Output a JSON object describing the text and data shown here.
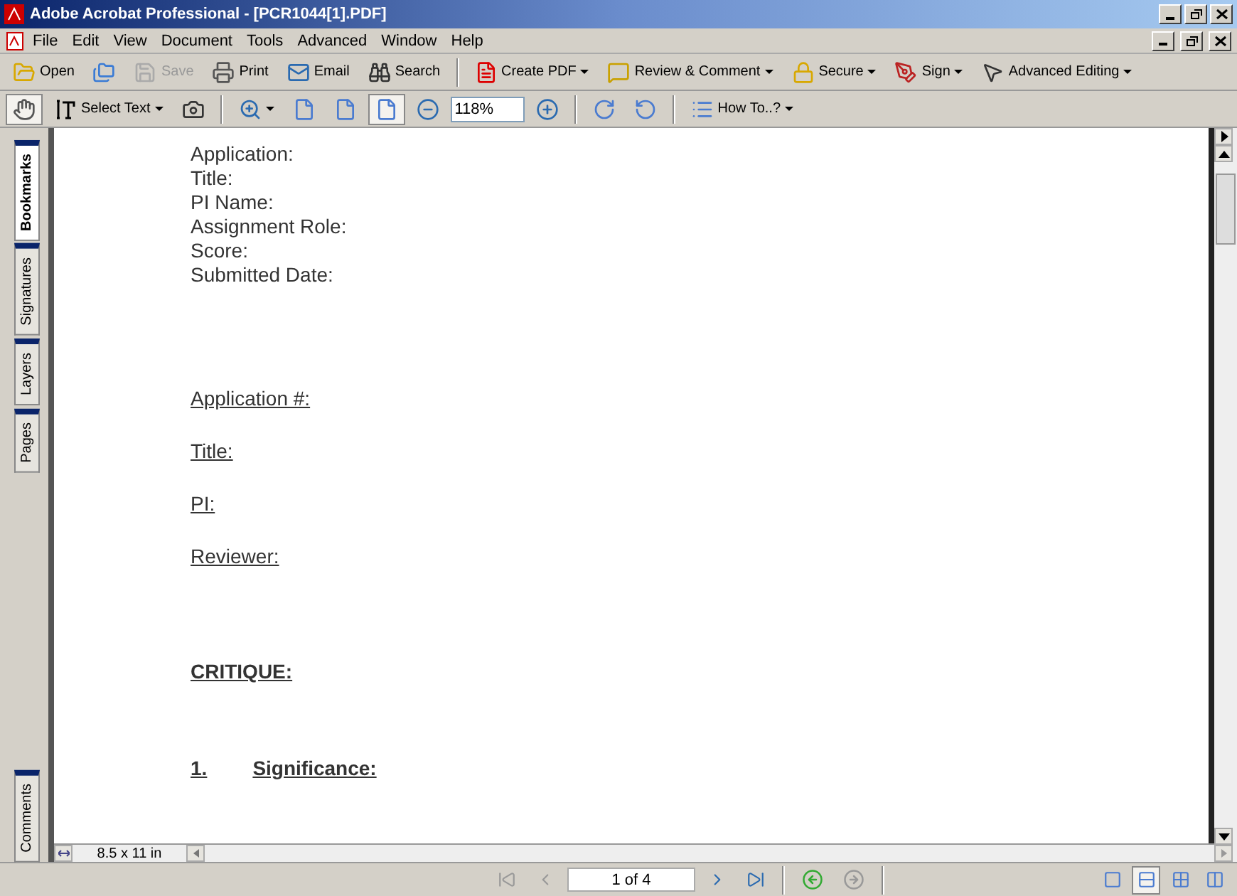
{
  "window": {
    "title": "Adobe Acrobat Professional - [PCR1044[1].PDF]"
  },
  "menu": [
    "File",
    "Edit",
    "View",
    "Document",
    "Tools",
    "Advanced",
    "Window",
    "Help"
  ],
  "toolbar_1": [
    {
      "kind": "open",
      "label": "Open",
      "disabled": false,
      "dropdown": false
    },
    {
      "kind": "organize",
      "disabled": false,
      "dropdown": false
    },
    {
      "kind": "save",
      "label": "Save",
      "disabled": true,
      "dropdown": false
    },
    {
      "kind": "print",
      "label": "Print",
      "disabled": false,
      "dropdown": false
    },
    {
      "kind": "email",
      "label": "Email",
      "disabled": false,
      "dropdown": false
    },
    {
      "kind": "search",
      "label": "Search",
      "disabled": false,
      "dropdown": false
    },
    {
      "kind": "sep"
    },
    {
      "kind": "pdf",
      "label": "Create PDF",
      "disabled": false,
      "dropdown": true
    },
    {
      "kind": "review",
      "label": "Review & Comment",
      "disabled": false,
      "dropdown": true
    },
    {
      "kind": "secure",
      "label": "Secure",
      "disabled": false,
      "dropdown": true
    },
    {
      "kind": "sign",
      "label": "Sign",
      "disabled": false,
      "dropdown": true
    },
    {
      "kind": "edit",
      "label": "Advanced Editing",
      "disabled": false,
      "dropdown": true
    }
  ],
  "toolbar_2": [
    {
      "kind": "hand",
      "selected": true,
      "dropdown": false
    },
    {
      "kind": "text",
      "label": "Select Text",
      "selected": false,
      "dropdown": true
    },
    {
      "kind": "snapshot",
      "selected": false,
      "dropdown": false
    },
    {
      "kind": "sep"
    },
    {
      "kind": "zoomin",
      "selected": false,
      "dropdown": true
    },
    {
      "kind": "page",
      "selected": false,
      "dropdown": false
    },
    {
      "kind": "fitpage",
      "selected": false,
      "dropdown": false
    },
    {
      "kind": "fitwidth",
      "selected": true,
      "dropdown": false
    },
    {
      "kind": "minus",
      "selected": false,
      "dropdown": false
    },
    {
      "kind": "zoomfield",
      "value": "118%"
    },
    {
      "kind": "plus",
      "selected": false,
      "dropdown": false
    },
    {
      "kind": "sep"
    },
    {
      "kind": "rotcw",
      "selected": false,
      "dropdown": false
    },
    {
      "kind": "rotccw",
      "selected": false,
      "dropdown": false
    },
    {
      "kind": "sep"
    },
    {
      "kind": "howto",
      "label": "How To..?",
      "selected": false,
      "dropdown": true
    }
  ],
  "side_tabs": [
    {
      "label": "Bookmarks",
      "selected": true
    },
    {
      "label": "Signatures",
      "selected": false
    },
    {
      "label": "Layers",
      "selected": false
    },
    {
      "label": "Pages",
      "selected": false
    },
    {
      "label": "Comments",
      "selected": false
    }
  ],
  "document": {
    "fields": [
      "Application:",
      "Title:",
      "PI Name:",
      "Assignment Role:",
      "Score:",
      "Submitted Date:"
    ],
    "headings": [
      "Application #:",
      "Title:",
      "PI:",
      "Reviewer:"
    ],
    "critique": "CRITIQUE:",
    "section": {
      "number": "1.",
      "title": "Significance:"
    }
  },
  "page_size": "8.5 x 11 in",
  "page_field": "1 of 4",
  "views": [
    {
      "kind": "single",
      "selected": false
    },
    {
      "kind": "continuous",
      "selected": true
    },
    {
      "kind": "facing",
      "selected": false
    },
    {
      "kind": "cfacing",
      "selected": false
    }
  ]
}
